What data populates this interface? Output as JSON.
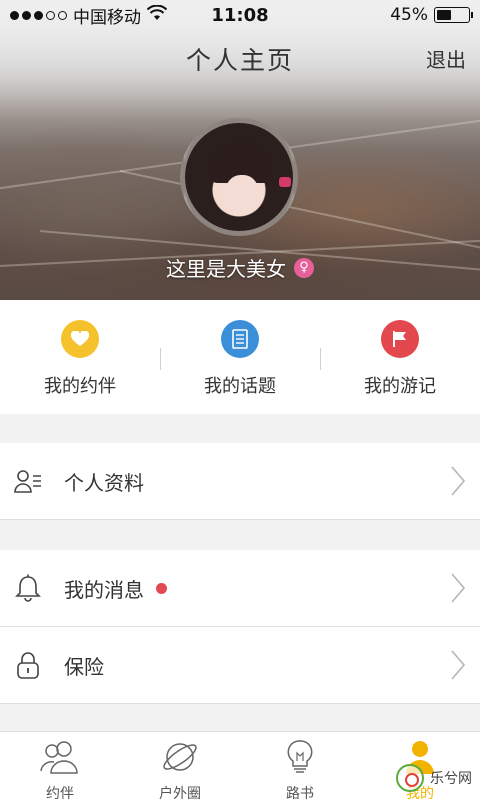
{
  "status_bar": {
    "carrier": "中国移动",
    "time": "11:08",
    "battery": "45%",
    "battery_level": 0.45
  },
  "header": {
    "title": "个人主页",
    "logout_label": "退出"
  },
  "profile": {
    "name": "这里是大美女",
    "gender_symbol": "♀"
  },
  "quick_actions": [
    {
      "label": "我的约伴",
      "icon": "heart-icon",
      "color": "#f5c22c"
    },
    {
      "label": "我的话题",
      "icon": "document-icon",
      "color": "#3a8fd8"
    },
    {
      "label": "我的游记",
      "icon": "flag-icon",
      "color": "#e2484d"
    }
  ],
  "menu": {
    "profile_label": "个人资料",
    "messages_label": "我的消息",
    "insurance_label": "保险"
  },
  "tabs": [
    {
      "label": "约伴",
      "icon": "users-icon"
    },
    {
      "label": "户外圈",
      "icon": "planet-icon"
    },
    {
      "label": "路书",
      "icon": "lightbulb-icon"
    },
    {
      "label": "我的",
      "icon": "person-icon",
      "active": true
    }
  ],
  "watermark": {
    "text": "乐兮网"
  },
  "colors": {
    "accent": "#f2b300",
    "unread": "#e04a50",
    "gender": "#e8609a"
  }
}
